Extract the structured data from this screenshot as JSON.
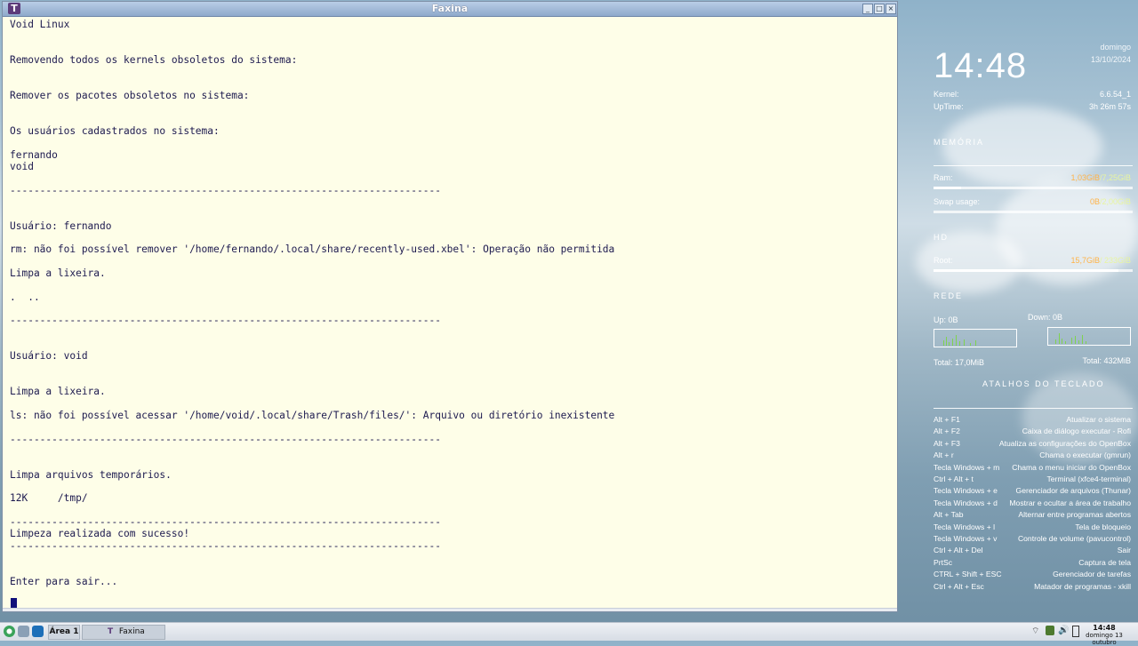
{
  "window": {
    "title": "Faxina",
    "app_icon": "T",
    "controls": {
      "minimize": "_",
      "maximize": "□",
      "close": "×"
    }
  },
  "terminal": {
    "lines": [
      "Void Linux",
      "Removendo todos os kernels obsoletos do sistema:",
      "Remover os pacotes obsoletos no sistema:",
      "Os usuários cadastrados no sistema:",
      "fernando",
      "void",
      "------------------------------------------------------------------------",
      "Usuário: fernando",
      "rm: não foi possível remover '/home/fernando/.local/share/recently-used.xbel': Operação não permitida",
      "Limpa a lixeira.",
      ".  ..",
      "------------------------------------------------------------------------",
      "Usuário: void",
      "Limpa a lixeira.",
      "ls: não foi possível acessar '/home/void/.local/share/Trash/files/': Arquivo ou diretório inexistente",
      "------------------------------------------------------------------------",
      "Limpa arquivos temporários.",
      "12K     /tmp/",
      "------------------------------------------------------------------------",
      "Limpeza realizada com sucesso!",
      "------------------------------------------------------------------------",
      "Enter para sair..."
    ]
  },
  "conky": {
    "time": "14:48",
    "day": "domingo",
    "date": "13/10/2024",
    "kernel_label": "Kernel:",
    "kernel_value": "6.6.54_1",
    "uptime_label": "UpTime:",
    "uptime_value": "3h 26m 57s",
    "memoria_title": "MEMÓRIA",
    "ram_label": "Ram:",
    "ram_used": "1,03GiB",
    "ram_total": "/7,25GiB",
    "ram_fraction": 0.14,
    "swap_label": "Swap usage:",
    "swap_used": "0B",
    "swap_total": "/2,00GiB",
    "swap_fraction": 0.0,
    "hd_title": "HD",
    "root_label": "Root:",
    "root_used": "15,7GiB",
    "root_total": "/ 233GiB",
    "root_fraction": 0.93,
    "rede_title": "REDE",
    "up_label": "Up: 0B",
    "down_label": "Down: 0B",
    "total_up": "Total: 17,0MiB",
    "total_down": "Total: 432MiB",
    "atalhos_title": "ATALHOS DO TECLADO",
    "shortcuts": [
      {
        "key": "Alt + F1",
        "action": "Atualizar o sistema"
      },
      {
        "key": "Alt + F2",
        "action": "Caixa de diálogo executar - Rofi"
      },
      {
        "key": "Alt + F3",
        "action": "Atualiza as configurações do OpenBox"
      },
      {
        "key": "Alt + r",
        "action": "Chama o executar (gmrun)"
      },
      {
        "key": "Tecla Windows + m",
        "action": "Chama o menu iniciar do OpenBox"
      },
      {
        "key": "Ctrl + Alt + t",
        "action": "Terminal (xfce4-terminal)"
      },
      {
        "key": "Tecla Windows + e",
        "action": "Gerenciador de arquivos (Thunar)"
      },
      {
        "key": "Tecla Windows + d",
        "action": "Mostrar e ocultar a área de trabalho"
      },
      {
        "key": "Alt + Tab",
        "action": "Alternar entre programas abertos"
      },
      {
        "key": "Tecla Windows + l",
        "action": "Tela de bloqueio"
      },
      {
        "key": "Tecla Windows + v",
        "action": "Controle de volume (pavucontrol)"
      },
      {
        "key": "Ctrl + Alt + Del",
        "action": "Sair"
      },
      {
        "key": "PrtSc",
        "action": "Captura de tela"
      },
      {
        "key": "CTRL + Shift + ESC",
        "action": "Gerenciador de tarefas"
      },
      {
        "key": "Ctrl + Alt + Esc",
        "action": "Matador de programas - xkill"
      }
    ]
  },
  "taskbar": {
    "workspace": "Área 1",
    "task": "Faxina",
    "clock_time": "14:48",
    "clock_date": "domingo 13 outubro",
    "icons": [
      "start-icon",
      "file-manager-icon",
      "terminal-icon"
    ],
    "tray_icons": [
      "wifi-icon",
      "update-icon",
      "volume-icon",
      "battery-icon"
    ]
  },
  "colors": {
    "terminal_bg": "#fefee8",
    "terminal_fg": "#1d1a4f",
    "titlebar": "#8ea9cb",
    "graph_green": "#7fd34f",
    "accent_orange": "#ffb347"
  }
}
